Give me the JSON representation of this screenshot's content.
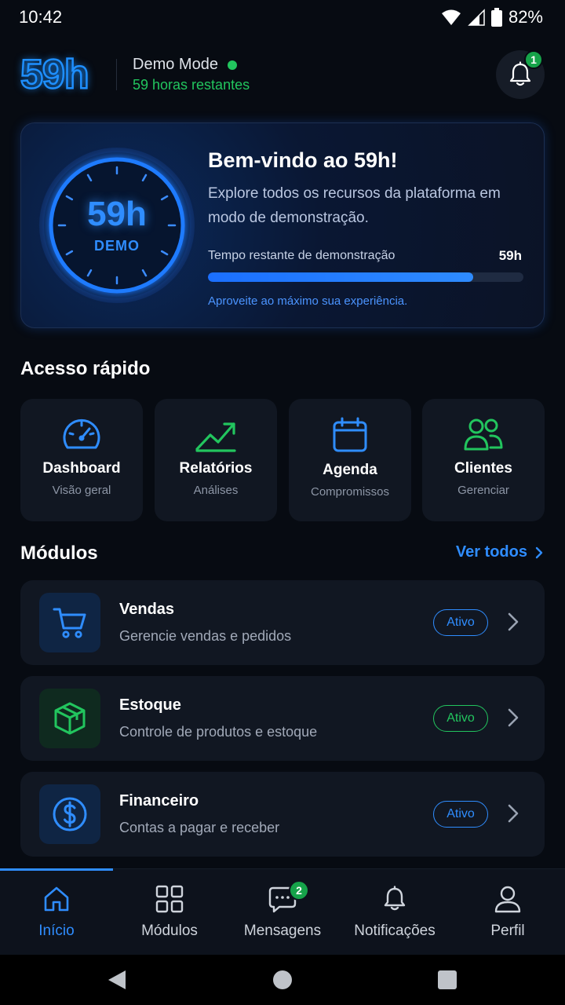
{
  "status_bar": {
    "time": "10:42",
    "battery": "82%"
  },
  "header": {
    "logo": "59h",
    "mode": "Demo Mode",
    "hours_left": "59 horas restantes",
    "notification_count": "1"
  },
  "welcome": {
    "dial_value": "59h",
    "dial_label": "DEMO",
    "title": "Bem-vindo ao 59h!",
    "description": "Explore todos os recursos da plataforma em modo de demonstração.",
    "progress_label": "Tempo restante de demonstração",
    "progress_value": "59h",
    "progress_fraction": 0.84,
    "note": "Aproveite ao máximo sua experiência."
  },
  "quick_access": {
    "title": "Acesso rápido",
    "items": [
      {
        "title": "Dashboard",
        "subtitle": "Visão geral",
        "icon": "speedometer-icon",
        "color": "#2f8dff"
      },
      {
        "title": "Relatórios",
        "subtitle": "Análises",
        "icon": "trending-up-icon",
        "color": "#22c55e"
      },
      {
        "title": "Agenda",
        "subtitle": "Compromissos",
        "icon": "calendar-icon",
        "color": "#2f8dff"
      },
      {
        "title": "Clientes",
        "subtitle": "Gerenciar",
        "icon": "users-icon",
        "color": "#22c55e"
      }
    ]
  },
  "modules": {
    "title": "Módulos",
    "see_all": "Ver todos",
    "items": [
      {
        "title": "Vendas",
        "subtitle": "Gerencie vendas e pedidos",
        "status": "Ativo",
        "icon": "cart-icon",
        "color": "#2f8dff"
      },
      {
        "title": "Estoque",
        "subtitle": "Controle de produtos e estoque",
        "status": "Ativo",
        "icon": "box-icon",
        "color": "#22c55e"
      },
      {
        "title": "Financeiro",
        "subtitle": "Contas a pagar e receber",
        "status": "Ativo",
        "icon": "dollar-icon",
        "color": "#2f8dff"
      }
    ]
  },
  "bottom_nav": {
    "items": [
      {
        "label": "Início",
        "icon": "home-icon",
        "active": true
      },
      {
        "label": "Módulos",
        "icon": "grid-icon"
      },
      {
        "label": "Mensagens",
        "icon": "chat-icon",
        "badge": "2"
      },
      {
        "label": "Notificações",
        "icon": "bell-icon"
      },
      {
        "label": "Perfil",
        "icon": "user-icon"
      }
    ]
  },
  "colors": {
    "accent_blue": "#2f8dff",
    "accent_green": "#22c55e",
    "background": "#070b12",
    "card": "#111722"
  }
}
